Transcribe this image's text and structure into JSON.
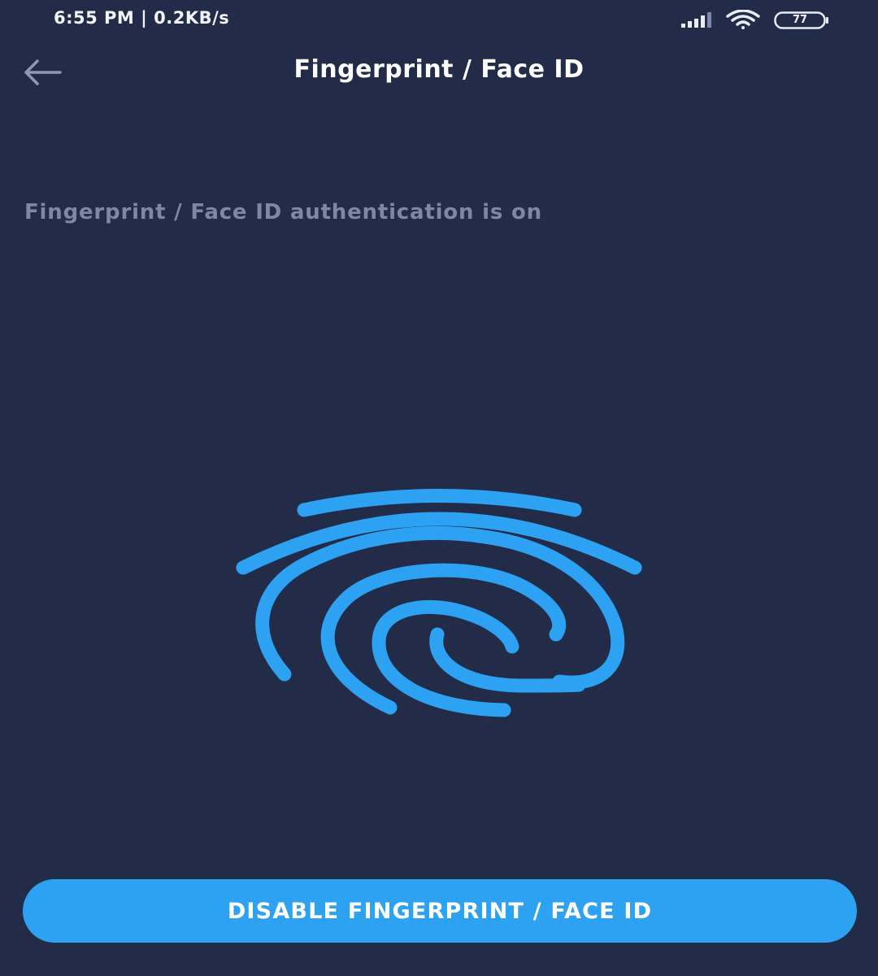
{
  "status_bar": {
    "time": "6:55 PM | 0.2KB/s",
    "battery": "77",
    "icons": [
      "signal-icon",
      "wifi-icon",
      "battery-icon"
    ]
  },
  "header": {
    "back_icon": "arrow-left-icon",
    "title": "Fingerprint / Face ID"
  },
  "main": {
    "status_message": "Fingerprint / Face ID authentication is on",
    "illustration_icon": "fingerprint-icon",
    "disable_button_label": "DISABLE FINGERPRINT / FACE ID"
  },
  "colors": {
    "background": "#222c48",
    "accent": "#2ea2f2",
    "muted_text": "#7e87a3",
    "title_text": "#ffffff"
  }
}
